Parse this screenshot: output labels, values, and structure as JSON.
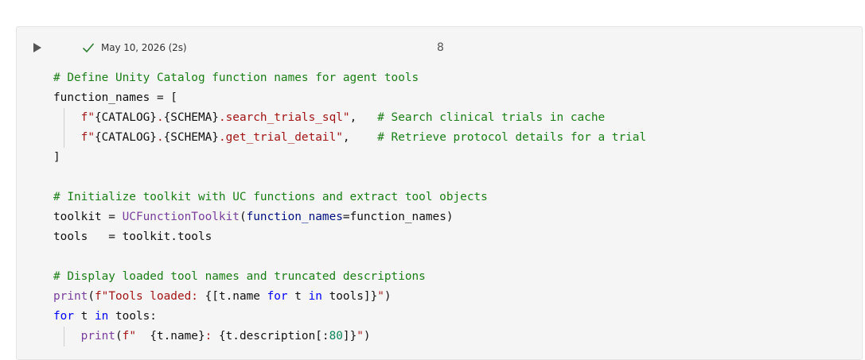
{
  "cell": {
    "run_icon": "play-icon",
    "status_icon": "check-icon",
    "status_text": "May 10, 2026 (2s)",
    "cell_number": "8",
    "colors": {
      "comment": "#1a7f16",
      "string": "#a31515",
      "function": "#7a3e9d",
      "keyword": "#0000ff",
      "number": "#098658",
      "parameter": "#001080"
    }
  },
  "code": {
    "lines": [
      {
        "indent": 0,
        "tokens": [
          {
            "t": "# Define Unity Catalog function names for agent tools",
            "c": "comment"
          }
        ]
      },
      {
        "indent": 0,
        "tokens": [
          {
            "t": "function_names = [",
            "c": "plain"
          }
        ]
      },
      {
        "indent": 1,
        "tokens": [
          {
            "t": "f\"",
            "c": "str"
          },
          {
            "t": "{CATALOG}",
            "c": "plain"
          },
          {
            "t": ".",
            "c": "str"
          },
          {
            "t": "{SCHEMA}",
            "c": "plain"
          },
          {
            "t": ".search_trials_sql\"",
            "c": "str"
          },
          {
            "t": ",   ",
            "c": "plain"
          },
          {
            "t": "# Search clinical trials in cache",
            "c": "comment"
          }
        ]
      },
      {
        "indent": 1,
        "tokens": [
          {
            "t": "f\"",
            "c": "str"
          },
          {
            "t": "{CATALOG}",
            "c": "plain"
          },
          {
            "t": ".",
            "c": "str"
          },
          {
            "t": "{SCHEMA}",
            "c": "plain"
          },
          {
            "t": ".get_trial_detail\"",
            "c": "str"
          },
          {
            "t": ",    ",
            "c": "plain"
          },
          {
            "t": "# Retrieve protocol details for a trial",
            "c": "comment"
          }
        ]
      },
      {
        "indent": 0,
        "tokens": [
          {
            "t": "]",
            "c": "plain"
          }
        ]
      },
      {
        "indent": 0,
        "tokens": [
          {
            "t": "",
            "c": "plain"
          }
        ]
      },
      {
        "indent": 0,
        "tokens": [
          {
            "t": "# Initialize toolkit with UC functions and extract tool objects",
            "c": "comment"
          }
        ]
      },
      {
        "indent": 0,
        "tokens": [
          {
            "t": "toolkit = ",
            "c": "plain"
          },
          {
            "t": "UCFunctionToolkit",
            "c": "fn"
          },
          {
            "t": "(",
            "c": "plain"
          },
          {
            "t": "function_names",
            "c": "param"
          },
          {
            "t": "=function_names)",
            "c": "plain"
          }
        ]
      },
      {
        "indent": 0,
        "tokens": [
          {
            "t": "tools   = toolkit.tools",
            "c": "plain"
          }
        ]
      },
      {
        "indent": 0,
        "tokens": [
          {
            "t": "",
            "c": "plain"
          }
        ]
      },
      {
        "indent": 0,
        "tokens": [
          {
            "t": "# Display loaded tool names and truncated descriptions",
            "c": "comment"
          }
        ]
      },
      {
        "indent": 0,
        "tokens": [
          {
            "t": "print",
            "c": "fn"
          },
          {
            "t": "(",
            "c": "plain"
          },
          {
            "t": "f\"Tools loaded: ",
            "c": "str"
          },
          {
            "t": "{[t.name ",
            "c": "plain"
          },
          {
            "t": "for",
            "c": "kw"
          },
          {
            "t": " t ",
            "c": "plain"
          },
          {
            "t": "in",
            "c": "kw"
          },
          {
            "t": " tools]}",
            "c": "plain"
          },
          {
            "t": "\"",
            "c": "str"
          },
          {
            "t": ")",
            "c": "plain"
          }
        ]
      },
      {
        "indent": 0,
        "tokens": [
          {
            "t": "for",
            "c": "kw"
          },
          {
            "t": " t ",
            "c": "plain"
          },
          {
            "t": "in",
            "c": "kw"
          },
          {
            "t": " tools:",
            "c": "plain"
          }
        ]
      },
      {
        "indent": 1,
        "tokens": [
          {
            "t": "print",
            "c": "fn"
          },
          {
            "t": "(",
            "c": "plain"
          },
          {
            "t": "f\"  ",
            "c": "str"
          },
          {
            "t": "{t.name}",
            "c": "plain"
          },
          {
            "t": ": ",
            "c": "str"
          },
          {
            "t": "{t.description[:",
            "c": "plain"
          },
          {
            "t": "80",
            "c": "num"
          },
          {
            "t": "]}",
            "c": "plain"
          },
          {
            "t": "\"",
            "c": "str"
          },
          {
            "t": ")",
            "c": "plain"
          }
        ]
      }
    ]
  }
}
